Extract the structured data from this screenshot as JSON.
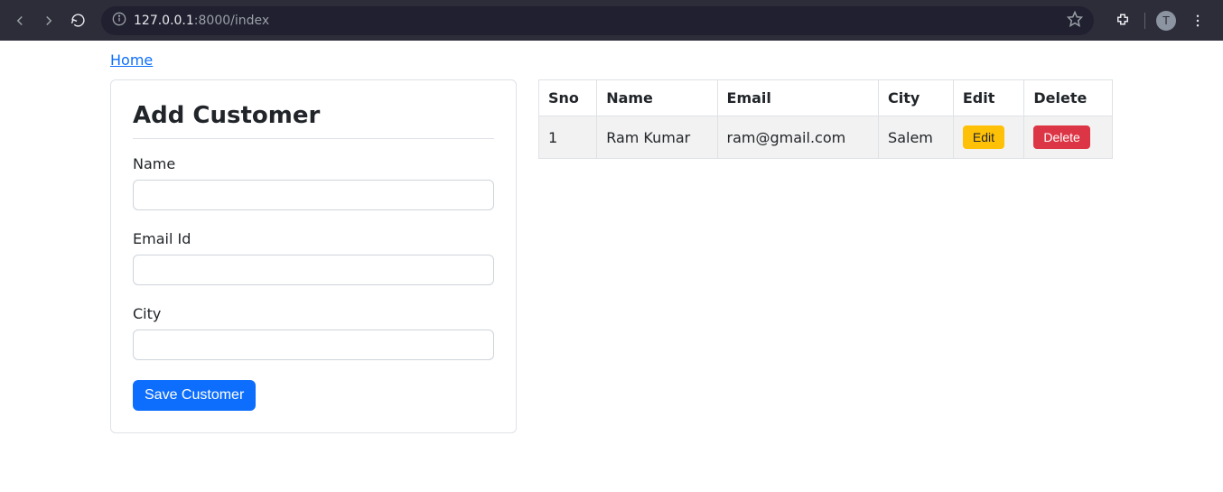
{
  "browser": {
    "url_host": "127.0.0.1",
    "url_port": ":8000",
    "url_path": "/index",
    "profile_letter": "T"
  },
  "nav": {
    "home_label": "Home"
  },
  "form": {
    "title": "Add Customer",
    "name_label": "Name",
    "name_value": "",
    "email_label": "Email Id",
    "email_value": "",
    "city_label": "City",
    "city_value": "",
    "submit_label": "Save Customer"
  },
  "table": {
    "headers": {
      "sno": "Sno",
      "name": "Name",
      "email": "Email",
      "city": "City",
      "edit": "Edit",
      "delete": "Delete"
    },
    "rows": [
      {
        "sno": "1",
        "name": "Ram Kumar",
        "email": "ram@gmail.com",
        "city": "Salem",
        "edit_label": "Edit",
        "delete_label": "Delete"
      }
    ]
  }
}
